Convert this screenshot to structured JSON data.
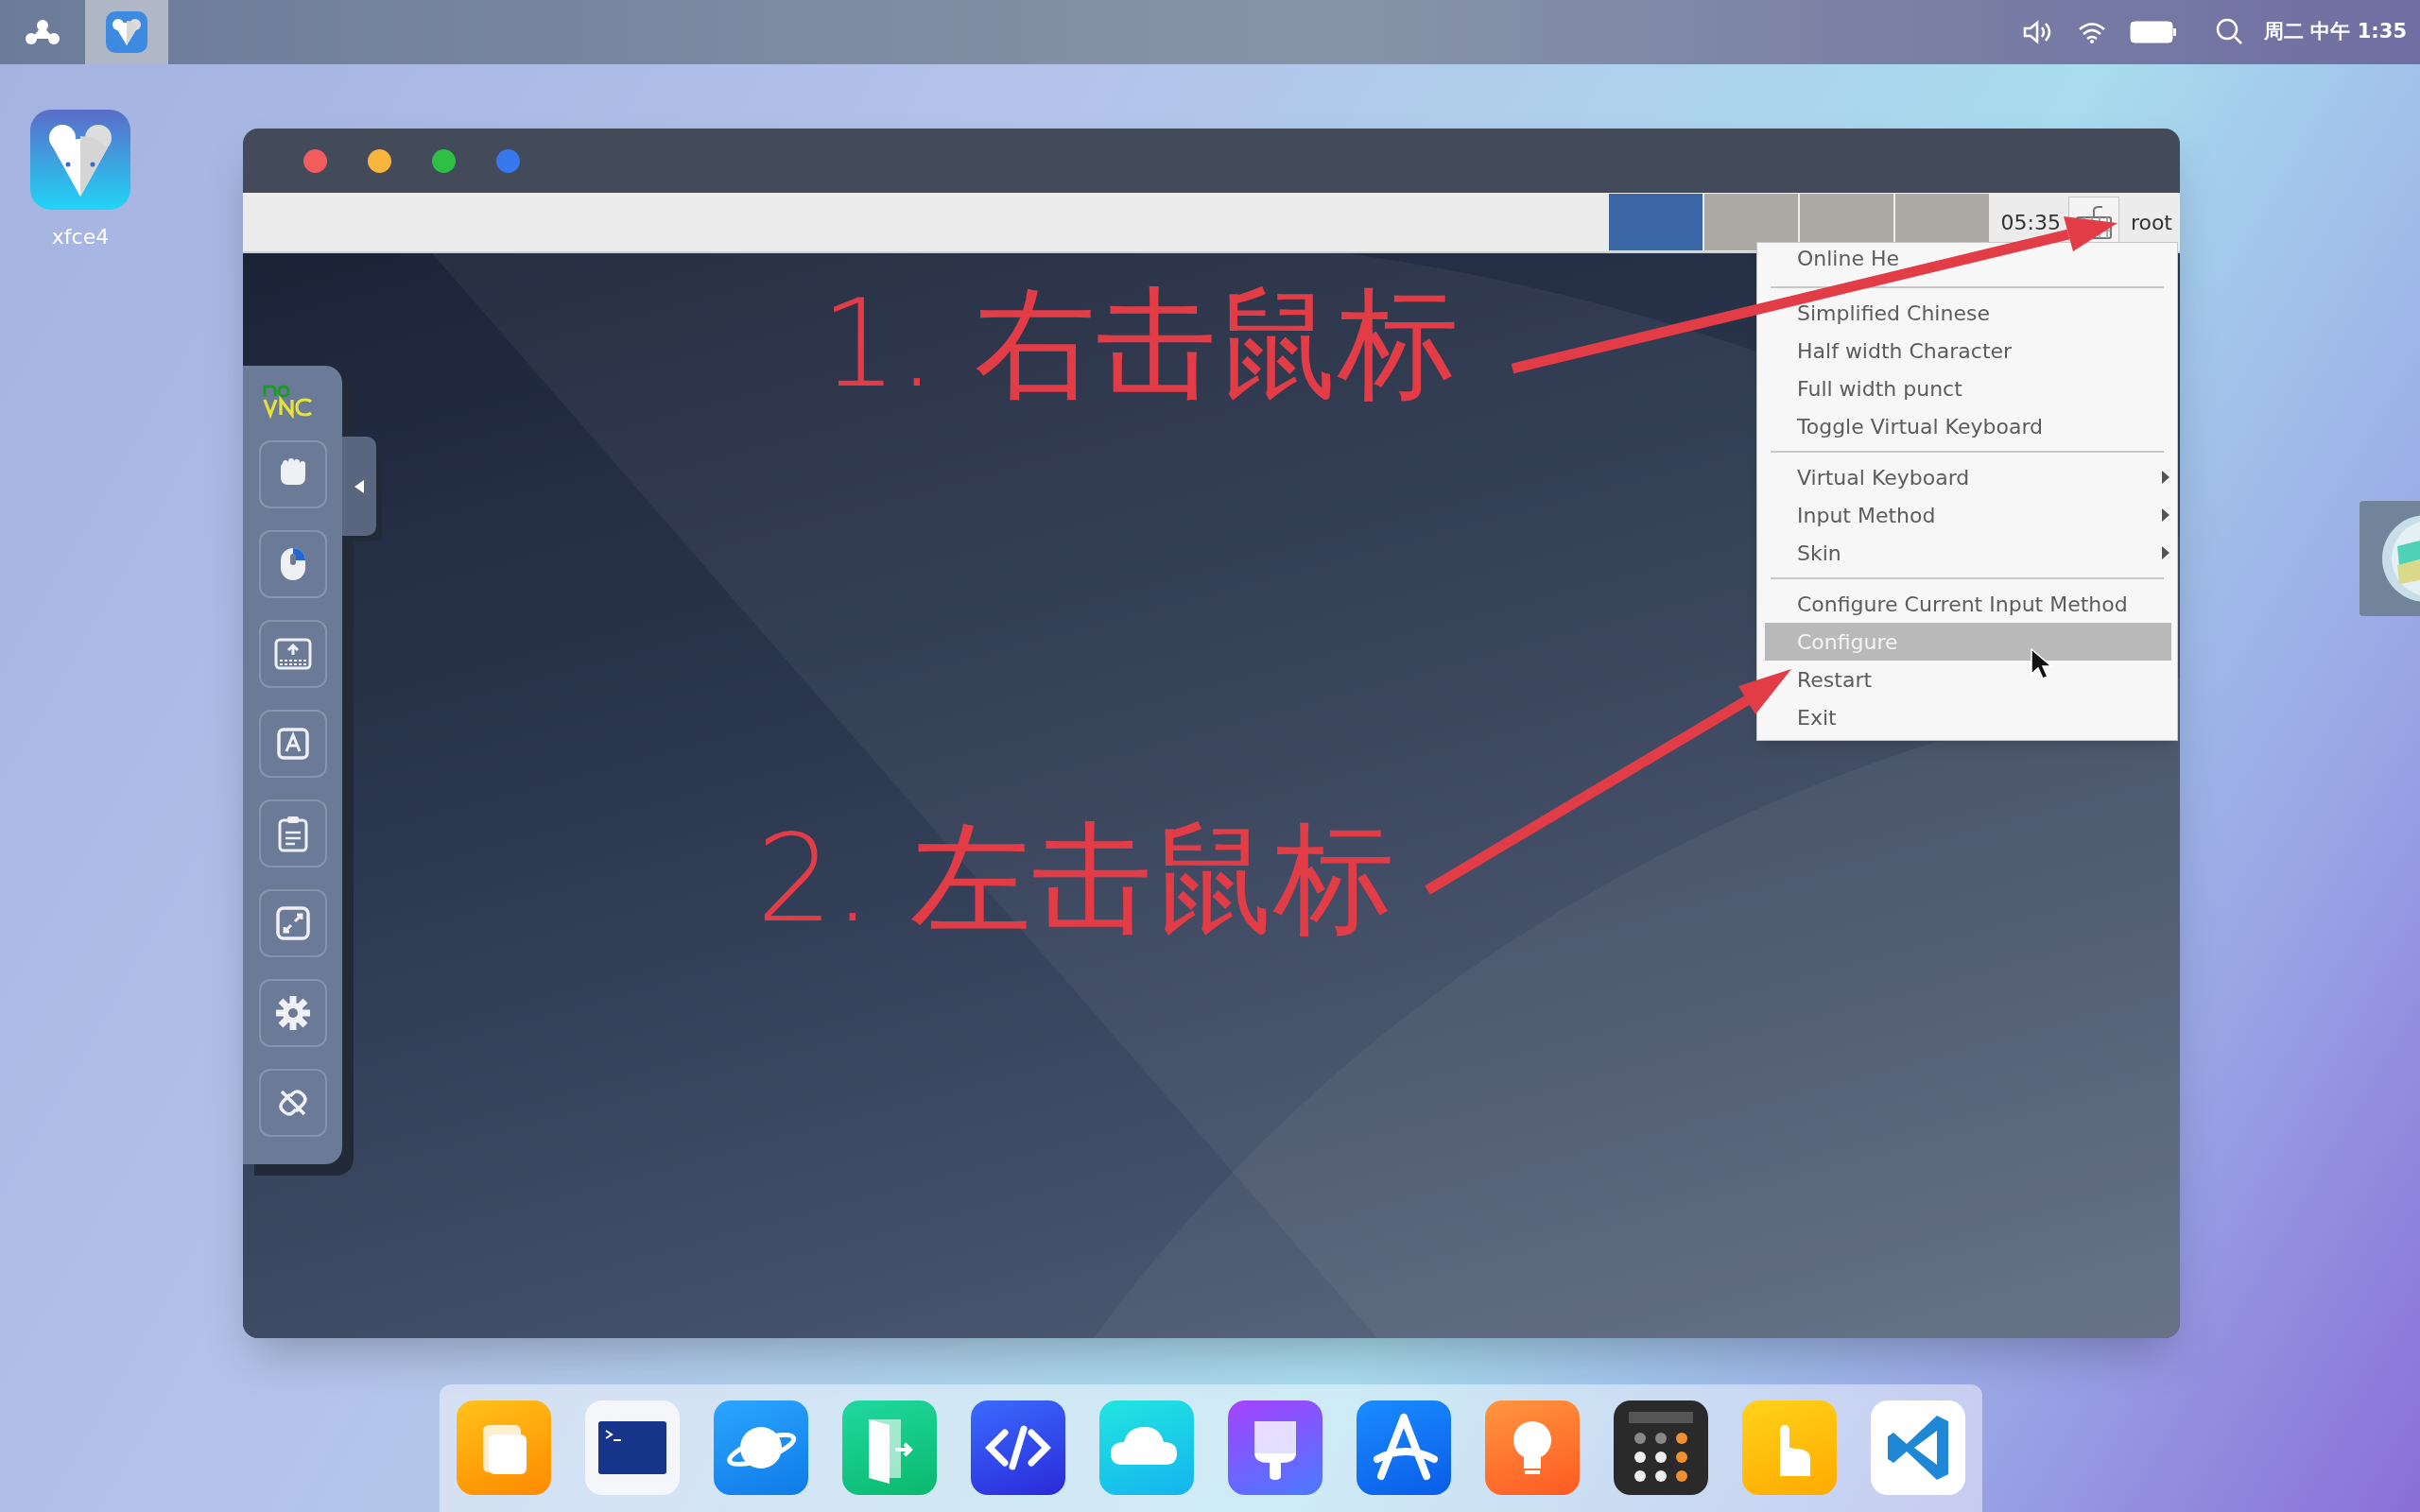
{
  "top_bar": {
    "clock": "周二 中午 1:35"
  },
  "desktop_icons": [
    {
      "label": "xfce4"
    }
  ],
  "window": {
    "panel": {
      "workspaces": [
        {
          "selected": true
        },
        {
          "selected": false
        },
        {
          "selected": false
        },
        {
          "selected": false
        }
      ],
      "clock": "05:35",
      "user": "root"
    },
    "context_menu": {
      "groups": [
        [
          {
            "label": "Online He",
            "submenu": false,
            "selected": false
          }
        ],
        [
          {
            "label": "Simplified Chinese",
            "submenu": false,
            "selected": false
          },
          {
            "label": "Half width Character",
            "submenu": false,
            "selected": false
          },
          {
            "label": "Full width punct",
            "submenu": false,
            "selected": false
          },
          {
            "label": "Toggle Virtual Keyboard",
            "submenu": false,
            "selected": false
          }
        ],
        [
          {
            "label": "Virtual Keyboard",
            "submenu": true,
            "selected": false
          },
          {
            "label": "Input Method",
            "submenu": true,
            "selected": false
          },
          {
            "label": "Skin",
            "submenu": true,
            "selected": false
          }
        ],
        [
          {
            "label": "Configure Current Input Method",
            "submenu": false,
            "selected": false
          },
          {
            "label": "Configure",
            "submenu": false,
            "selected": true
          },
          {
            "label": "Restart",
            "submenu": false,
            "selected": false
          },
          {
            "label": "Exit",
            "submenu": false,
            "selected": false
          }
        ]
      ]
    }
  },
  "annotations": [
    {
      "text": "1. 右击鼠标"
    },
    {
      "text": "2. 左击鼠标"
    }
  ]
}
